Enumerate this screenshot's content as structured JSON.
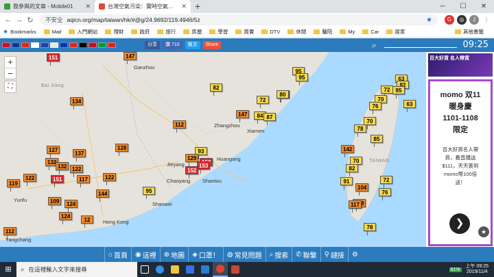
{
  "browser": {
    "tabs": [
      {
        "title": "我參與的文章 - Mobile01",
        "color": "#3a9b3a"
      },
      {
        "title": "台灣空氣污染：實時空氣質量指數地圖",
        "color": "#d94a3a"
      }
    ],
    "new_tab": "+",
    "url_security": "不安全",
    "url": "aqicn.org/map/taiwan/hk/#@g/24.9692/119.4946/5z"
  },
  "bookmarks": {
    "apps_label": "Bookmarks",
    "items": [
      "Mail",
      "入門網站",
      "理財",
      "政府",
      "旅行",
      "房屋",
      "學習",
      "買賣",
      "DTV",
      "休閒",
      "醫院",
      "My",
      "Car",
      "居家"
    ],
    "other": "其他書籤"
  },
  "site": {
    "share_fb": "分享",
    "like": "讚 710",
    "tweet": "推文",
    "share": "Share",
    "clock": "09:25"
  },
  "map": {
    "zoom_in": "+",
    "zoom_out": "−",
    "labels": [
      {
        "text": "Ganzhou",
        "cls": "city"
      },
      {
        "text": "Zhangzhou",
        "cls": "city"
      },
      {
        "text": "Xiamen",
        "cls": "city"
      },
      {
        "text": "Huangang",
        "cls": "city"
      },
      {
        "text": "Shantou",
        "cls": "city"
      },
      {
        "text": "Jieyang",
        "cls": "city"
      },
      {
        "text": "Chaoyang",
        "cls": "city"
      },
      {
        "text": "Shanwei",
        "cls": "city"
      },
      {
        "text": "Hong Kong",
        "cls": "city"
      },
      {
        "text": "Yunfu",
        "cls": "city"
      },
      {
        "text": "Yangchang",
        "cls": "city"
      },
      {
        "text": "TAIWAN",
        "cls": "region"
      },
      {
        "text": "Bai Jiang",
        "cls": "region"
      }
    ],
    "markers": [
      {
        "v": "151",
        "c": "#e0262c",
        "fg": "#fff"
      },
      {
        "v": "147",
        "c": "#f08b2a",
        "fg": "#000"
      },
      {
        "v": "82",
        "c": "#f5d84a",
        "fg": "#000"
      },
      {
        "v": "95",
        "c": "#f5d84a",
        "fg": "#000"
      },
      {
        "v": "95",
        "c": "#f5d84a",
        "fg": "#000"
      },
      {
        "v": "80",
        "c": "#f5d84a",
        "fg": "#000"
      },
      {
        "v": "72",
        "c": "#f5d84a",
        "fg": "#000"
      },
      {
        "v": "134",
        "c": "#f08b2a",
        "fg": "#000"
      },
      {
        "v": "147",
        "c": "#f08b2a",
        "fg": "#000"
      },
      {
        "v": "84",
        "c": "#f5d84a",
        "fg": "#000"
      },
      {
        "v": "87",
        "c": "#f5d84a",
        "fg": "#000"
      },
      {
        "v": "112",
        "c": "#f08b2a",
        "fg": "#000"
      },
      {
        "v": "93",
        "c": "#f5d84a",
        "fg": "#000"
      },
      {
        "v": "129",
        "c": "#f08b2a",
        "fg": "#000"
      },
      {
        "v": "152",
        "c": "#e0262c",
        "fg": "#fff"
      },
      {
        "v": "153",
        "c": "#e0262c",
        "fg": "#fff"
      },
      {
        "v": "152",
        "c": "#e0262c",
        "fg": "#fff"
      },
      {
        "v": "127",
        "c": "#f08b2a",
        "fg": "#000"
      },
      {
        "v": "137",
        "c": "#f08b2a",
        "fg": "#000"
      },
      {
        "v": "128",
        "c": "#f08b2a",
        "fg": "#000"
      },
      {
        "v": "132",
        "c": "#f08b2a",
        "fg": "#000"
      },
      {
        "v": "132",
        "c": "#f08b2a",
        "fg": "#000"
      },
      {
        "v": "122",
        "c": "#f08b2a",
        "fg": "#000"
      },
      {
        "v": "151",
        "c": "#e0262c",
        "fg": "#fff"
      },
      {
        "v": "117",
        "c": "#f08b2a",
        "fg": "#000"
      },
      {
        "v": "122",
        "c": "#f08b2a",
        "fg": "#000"
      },
      {
        "v": "119",
        "c": "#f08b2a",
        "fg": "#000"
      },
      {
        "v": "122",
        "c": "#f08b2a",
        "fg": "#000"
      },
      {
        "v": "95",
        "c": "#f5d84a",
        "fg": "#000"
      },
      {
        "v": "144",
        "c": "#f08b2a",
        "fg": "#000"
      },
      {
        "v": "109",
        "c": "#f08b2a",
        "fg": "#000"
      },
      {
        "v": "124",
        "c": "#f08b2a",
        "fg": "#000"
      },
      {
        "v": "124",
        "c": "#f08b2a",
        "fg": "#000"
      },
      {
        "v": "12",
        "c": "#f08b2a",
        "fg": "#000"
      },
      {
        "v": "112",
        "c": "#f08b2a",
        "fg": "#000"
      },
      {
        "v": "80",
        "c": "#f5d84a",
        "fg": "#000"
      },
      {
        "v": "63",
        "c": "#f5d84a",
        "fg": "#000"
      },
      {
        "v": "72",
        "c": "#f5d84a",
        "fg": "#000"
      },
      {
        "v": "82",
        "c": "#f5d84a",
        "fg": "#000"
      },
      {
        "v": "95",
        "c": "#f5d84a",
        "fg": "#000"
      },
      {
        "v": "70",
        "c": "#f5d84a",
        "fg": "#000"
      },
      {
        "v": "76",
        "c": "#f5d84a",
        "fg": "#000"
      },
      {
        "v": "63",
        "c": "#f5d84a",
        "fg": "#000"
      },
      {
        "v": "70",
        "c": "#f5d84a",
        "fg": "#000"
      },
      {
        "v": "78",
        "c": "#f5d84a",
        "fg": "#000"
      },
      {
        "v": "85",
        "c": "#f5d84a",
        "fg": "#000"
      },
      {
        "v": "142",
        "c": "#f08b2a",
        "fg": "#000"
      },
      {
        "v": "70",
        "c": "#f5d84a",
        "fg": "#000"
      },
      {
        "v": "82",
        "c": "#f5d84a",
        "fg": "#000"
      },
      {
        "v": "91",
        "c": "#f5d84a",
        "fg": "#000"
      },
      {
        "v": "72",
        "c": "#f5d84a",
        "fg": "#000"
      },
      {
        "v": "104",
        "c": "#f08b2a",
        "fg": "#000"
      },
      {
        "v": "76",
        "c": "#f5d84a",
        "fg": "#000"
      },
      {
        "v": "109",
        "c": "#f08b2a",
        "fg": "#000"
      },
      {
        "v": "117",
        "c": "#f08b2a",
        "fg": "#000"
      },
      {
        "v": "78",
        "c": "#f5d84a",
        "fg": "#000"
      }
    ]
  },
  "ad": {
    "banner_title": "百大好貨 名人帶貨",
    "headline": [
      "momo 双11",
      "暖身慶",
      "1101-1108",
      "限定"
    ],
    "body": [
      "百大好貨名人帶",
      "貨，看直播送",
      "$111，天天簽到",
      "momo幣100倍",
      "送！"
    ],
    "next": "❯"
  },
  "nav": [
    {
      "icon": "⌂",
      "label": "首頁"
    },
    {
      "icon": "◉",
      "label": "這裡"
    },
    {
      "icon": "⊕",
      "label": "地圖"
    },
    {
      "icon": "◈",
      "label": "口罩！"
    },
    {
      "icon": "◍",
      "label": "常見問題"
    },
    {
      "icon": "⌕",
      "label": "搜索"
    },
    {
      "icon": "✆",
      "label": "聯繫"
    },
    {
      "icon": "⚲",
      "label": "鏈接"
    },
    {
      "icon": "⚙",
      "label": ""
    }
  ],
  "taskbar": {
    "search_placeholder": "在這裡輸入文字來搜尋",
    "battery": "81%",
    "time": "上午 09:25",
    "date": "2019/11/4"
  }
}
